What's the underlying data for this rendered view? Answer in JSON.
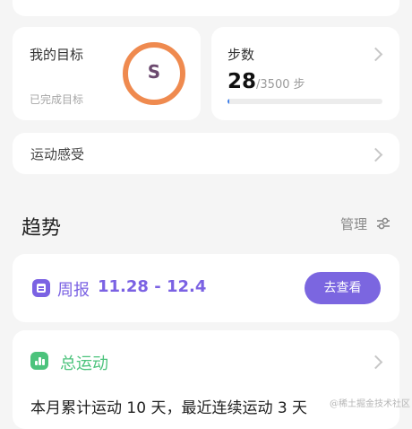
{
  "goal": {
    "title": "我的目标",
    "subtitle": "已完成目标",
    "ring_letter": "S"
  },
  "steps": {
    "title": "步数",
    "count": "28",
    "target": "/3500",
    "unit": "步",
    "progress_fraction": 0.008
  },
  "feeling": {
    "label": "运动感受"
  },
  "trend": {
    "title": "趋势",
    "manage_label": "管理"
  },
  "weekly": {
    "label": "周报",
    "range": "11.28 - 12.4",
    "button_label": "去查看"
  },
  "total": {
    "label": "总运动",
    "summary": "本月累计运动 10 天，最近连续运动 3 天"
  },
  "watermark": "@稀土掘金技术社区",
  "colors": {
    "accent_purple": "#7b62e3",
    "accent_green": "#4cc37c",
    "ring_orange": "#ef8a4f",
    "progress_blue": "#3b7dea"
  },
  "icons": {
    "weekly": "report-icon",
    "total": "bar-chart-icon",
    "manage": "sliders-icon",
    "chevron": "chevron-right-icon"
  }
}
